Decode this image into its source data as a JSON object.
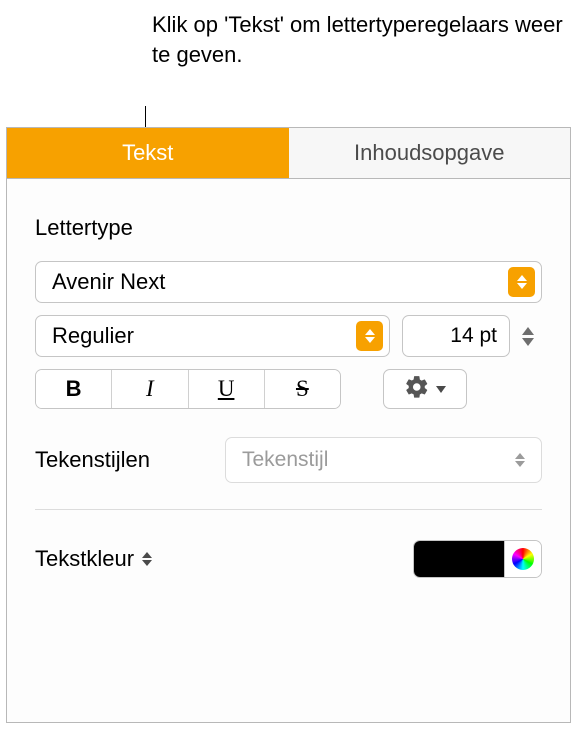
{
  "callout": "Klik op 'Tekst' om lettertyperegelaars weer te geven.",
  "tabs": {
    "text": "Tekst",
    "toc": "Inhoudsopgave"
  },
  "font": {
    "section_label": "Lettertype",
    "family": "Avenir Next",
    "weight": "Regulier",
    "size": "14 pt",
    "bold": "B",
    "italic": "I",
    "underline": "U",
    "strike": "S"
  },
  "charstyle": {
    "label": "Tekenstijlen",
    "placeholder": "Tekenstijl"
  },
  "textcolor": {
    "label": "Tekstkleur",
    "value": "#000000"
  }
}
